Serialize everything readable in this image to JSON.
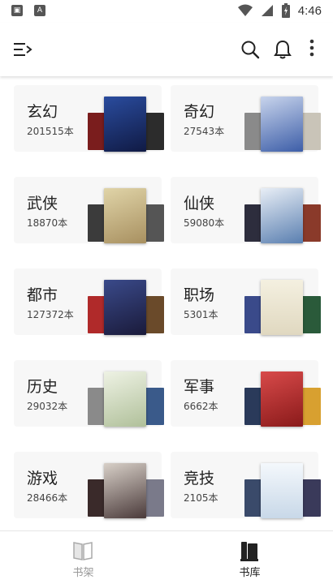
{
  "status_bar": {
    "time": "4:46",
    "left_icons": [
      "app-icon",
      "app-a-icon"
    ],
    "right_icons": [
      "wifi-icon",
      "signal-icon",
      "battery-icon"
    ]
  },
  "toolbar": {
    "icons": [
      "menu-icon",
      "search-icon",
      "bell-icon",
      "more-vertical-icon"
    ]
  },
  "categories": [
    {
      "name": "玄幻",
      "count": "201515本",
      "cover_colors": [
        "#7a1d1d",
        "#1b2f6b",
        "#2c2c2c"
      ]
    },
    {
      "name": "奇幻",
      "count": "27543本",
      "cover_colors": [
        "#8a8a8a",
        "#3d5ea8",
        "#c9c4b8"
      ]
    },
    {
      "name": "武侠",
      "count": "18870本",
      "cover_colors": [
        "#3b3b3b",
        "#c9b88a",
        "#555555"
      ]
    },
    {
      "name": "仙侠",
      "count": "59080本",
      "cover_colors": [
        "#2d2d3d",
        "#5a7fb0",
        "#8a3a2a"
      ]
    },
    {
      "name": "都市",
      "count": "127372本",
      "cover_colors": [
        "#b02a2a",
        "#2a3a6a",
        "#6a4a2a"
      ]
    },
    {
      "name": "职场",
      "count": "5301本",
      "cover_colors": [
        "#3a4a8a",
        "#e8e0c8",
        "#2a5a3a"
      ]
    },
    {
      "name": "历史",
      "count": "29032本",
      "cover_colors": [
        "#8a8a8a",
        "#c8d0b8",
        "#3a5a8a"
      ]
    },
    {
      "name": "军事",
      "count": "6662本",
      "cover_colors": [
        "#2a3a5a",
        "#b83a3a",
        "#d8a030"
      ]
    },
    {
      "name": "游戏",
      "count": "28466本",
      "cover_colors": [
        "#3a2a2a",
        "#c8c0b8",
        "#7a7a8a"
      ]
    },
    {
      "name": "竞技",
      "count": "2105本",
      "cover_colors": [
        "#3a4a6a",
        "#e8eef4",
        "#3a3a5a"
      ]
    }
  ],
  "bottom_nav": {
    "bookshelf": {
      "label": "书架",
      "icon": "open-book-icon",
      "active": false
    },
    "library": {
      "label": "书库",
      "icon": "books-icon",
      "active": true
    }
  },
  "colors": {
    "card_bg": "#f7f7f7",
    "text_primary": "#222222",
    "text_secondary": "#444444",
    "nav_inactive": "#999999"
  }
}
